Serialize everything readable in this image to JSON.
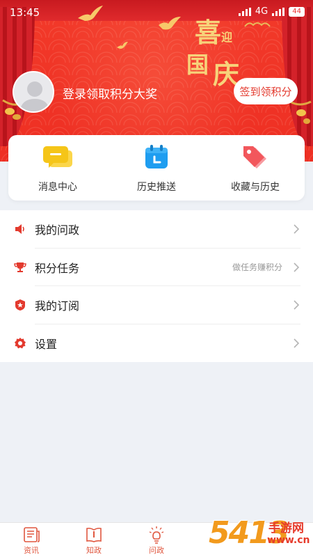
{
  "status_bar": {
    "time": "13:45",
    "network": "4G",
    "battery": "44"
  },
  "banner": {
    "logo_text": [
      "喜",
      "迎",
      "国",
      "庆"
    ],
    "login_prompt": "登录领取积分大奖",
    "sign_in_button": "签到领积分"
  },
  "quick_actions": [
    {
      "label": "消息中心",
      "icon": "message-icon",
      "color": "#f5c518"
    },
    {
      "label": "历史推送",
      "icon": "calendar-icon",
      "color": "#1e9df0"
    },
    {
      "label": "收藏与历史",
      "icon": "tag-icon",
      "color": "#f2575c"
    }
  ],
  "menu": [
    {
      "label": "我的问政",
      "hint": "",
      "icon": "speaker-icon"
    },
    {
      "label": "积分任务",
      "hint": "做任务赚积分",
      "icon": "trophy-icon"
    },
    {
      "label": "我的订阅",
      "hint": "",
      "icon": "star-badge-icon"
    },
    {
      "label": "设置",
      "hint": "",
      "icon": "gear-icon"
    }
  ],
  "bottom_nav": [
    {
      "label": "资讯",
      "icon": "news-icon"
    },
    {
      "label": "知政",
      "icon": "book-icon"
    },
    {
      "label": "问政",
      "icon": "bulb-icon"
    }
  ],
  "watermark": {
    "digits": "5413",
    "site_name": "手游网",
    "site_url": "www.cn"
  },
  "colors": {
    "brand_red": "#ee2f23",
    "gold": "#f7d37a",
    "nav_active": "#e0573f"
  }
}
